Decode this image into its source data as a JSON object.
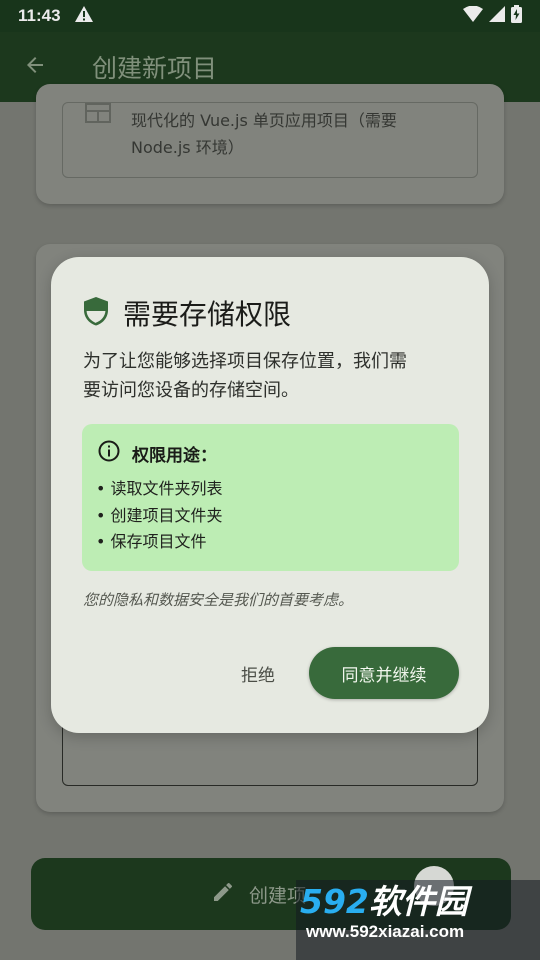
{
  "status_bar": {
    "time": "11:43",
    "icons": [
      "warning-icon",
      "wifi-icon",
      "signal-icon",
      "battery-charging-icon"
    ]
  },
  "app_bar": {
    "title": "创建新项目",
    "back_icon": "arrow-back-icon"
  },
  "background": {
    "option_text_line1": "现代化的 Vue.js 单页应用项目（需要",
    "option_text_line2": "Node.js 环境）",
    "create_button_label": "创建项"
  },
  "dialog": {
    "title": "需要存储权限",
    "body_line1": "为了让您能够选择项目保存位置，我们需",
    "body_line2": "要访问您设备的存储空间。",
    "usage": {
      "title": "权限用途：",
      "items": [
        "• 读取文件夹列表",
        "• 创建项目文件夹",
        "• 保存项目文件"
      ]
    },
    "privacy_note": "您的隐私和数据安全是我们的首要考虑。",
    "deny_label": "拒绝",
    "agree_label": "同意并继续"
  },
  "watermark": {
    "logo_number": "592",
    "logo_text": "软件园",
    "url": "www.592xiazai.com"
  },
  "colors": {
    "app_bar": "#1f3d20",
    "primary": "#386a3b",
    "info_bg": "#bdedb4",
    "dialog_bg": "#e6e9e1"
  }
}
